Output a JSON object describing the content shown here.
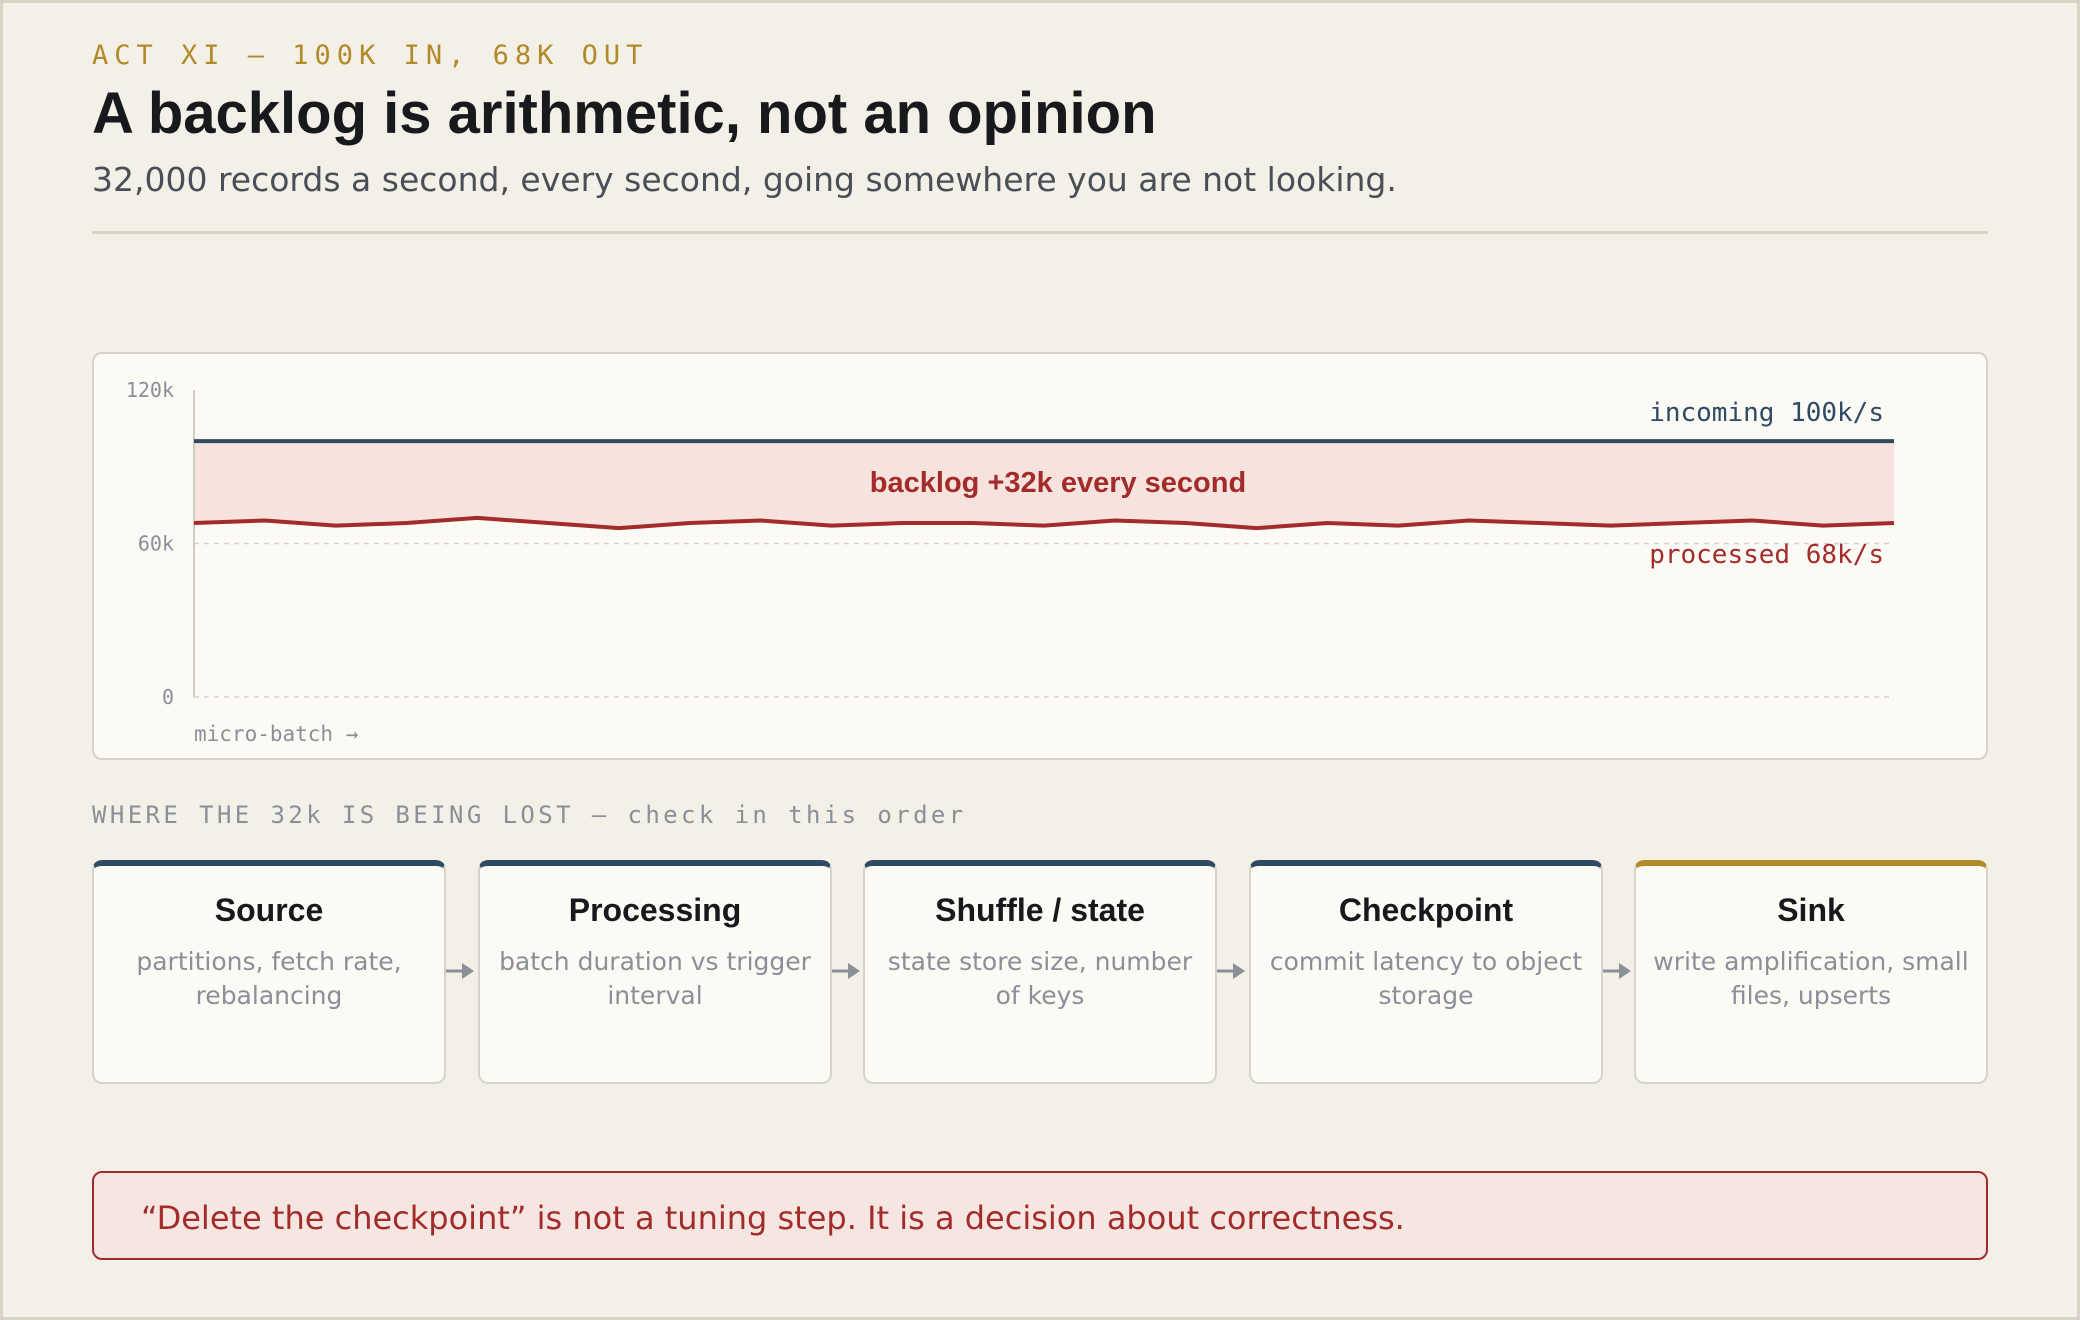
{
  "header": {
    "kicker": "ACT XI — 100K IN, 68K OUT",
    "title": "A backlog is arithmetic, not an opinion",
    "subtitle": "32,000 records a second, every second, going somewhere you are not looking."
  },
  "chart_data": {
    "type": "line",
    "ylim": [
      0,
      120000
    ],
    "y_ticks": [
      {
        "value": 120000,
        "label": "120k"
      },
      {
        "value": 60000,
        "label": "60k"
      },
      {
        "value": 0,
        "label": "0"
      }
    ],
    "xlabel": "micro-batch →",
    "gridlines": [
      60000
    ],
    "series": [
      {
        "name": "incoming 100k/s",
        "color": "#2f4b63",
        "values": [
          100000,
          100000,
          100000,
          100000,
          100000,
          100000,
          100000,
          100000,
          100000,
          100000,
          100000,
          100000,
          100000,
          100000,
          100000,
          100000,
          100000,
          100000,
          100000,
          100000,
          100000,
          100000,
          100000,
          100000,
          100000
        ]
      },
      {
        "name": "processed 68k/s",
        "color": "#a32c2b",
        "values": [
          68000,
          69000,
          67000,
          68000,
          70000,
          68000,
          66000,
          68000,
          69000,
          67000,
          68000,
          68000,
          67000,
          69000,
          68000,
          66000,
          68000,
          67000,
          69000,
          68000,
          67000,
          68000,
          69000,
          67000,
          68000
        ]
      }
    ],
    "band": {
      "label": "backlog +32k every second",
      "color": "#f6e3de",
      "label_color": "#a32c2b"
    }
  },
  "stages": {
    "heading": "WHERE THE 32k IS BEING LOST — check in this order",
    "items": [
      {
        "title": "Source",
        "desc": "partitions, fetch rate, rebalancing"
      },
      {
        "title": "Processing",
        "desc": "batch duration vs trigger interval"
      },
      {
        "title": "Shuffle / state",
        "desc": "state store size, number of keys"
      },
      {
        "title": "Checkpoint",
        "desc": "commit latency to object storage"
      },
      {
        "title": "Sink",
        "desc": "write amplification, small files, upserts"
      }
    ]
  },
  "callout": {
    "text": "“Delete the checkpoint” is not a tuning step. It is a decision about correctness."
  },
  "colors": {
    "accent_gold": "#b38a2a",
    "incoming_navy": "#2f4b63",
    "processed_red": "#a32c2b"
  }
}
